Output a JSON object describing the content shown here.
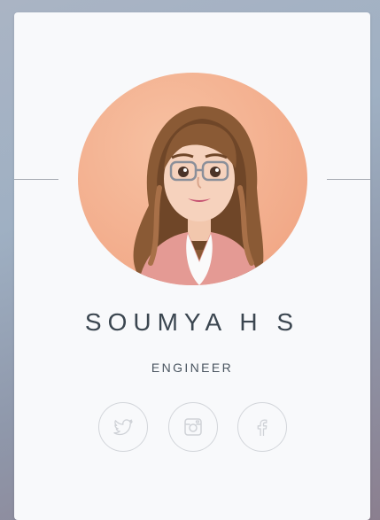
{
  "profile": {
    "name": "SOUMYA H S",
    "title": "ENGINEER"
  },
  "socials": [
    {
      "icon": "twitter-icon"
    },
    {
      "icon": "instagram-icon"
    },
    {
      "icon": "facebook-icon"
    }
  ],
  "colors": {
    "card_background": "#f8f9fb",
    "text": "#3b4650",
    "avatar_background": "#f2ab8a",
    "icon_stroke": "#d2d5da"
  }
}
